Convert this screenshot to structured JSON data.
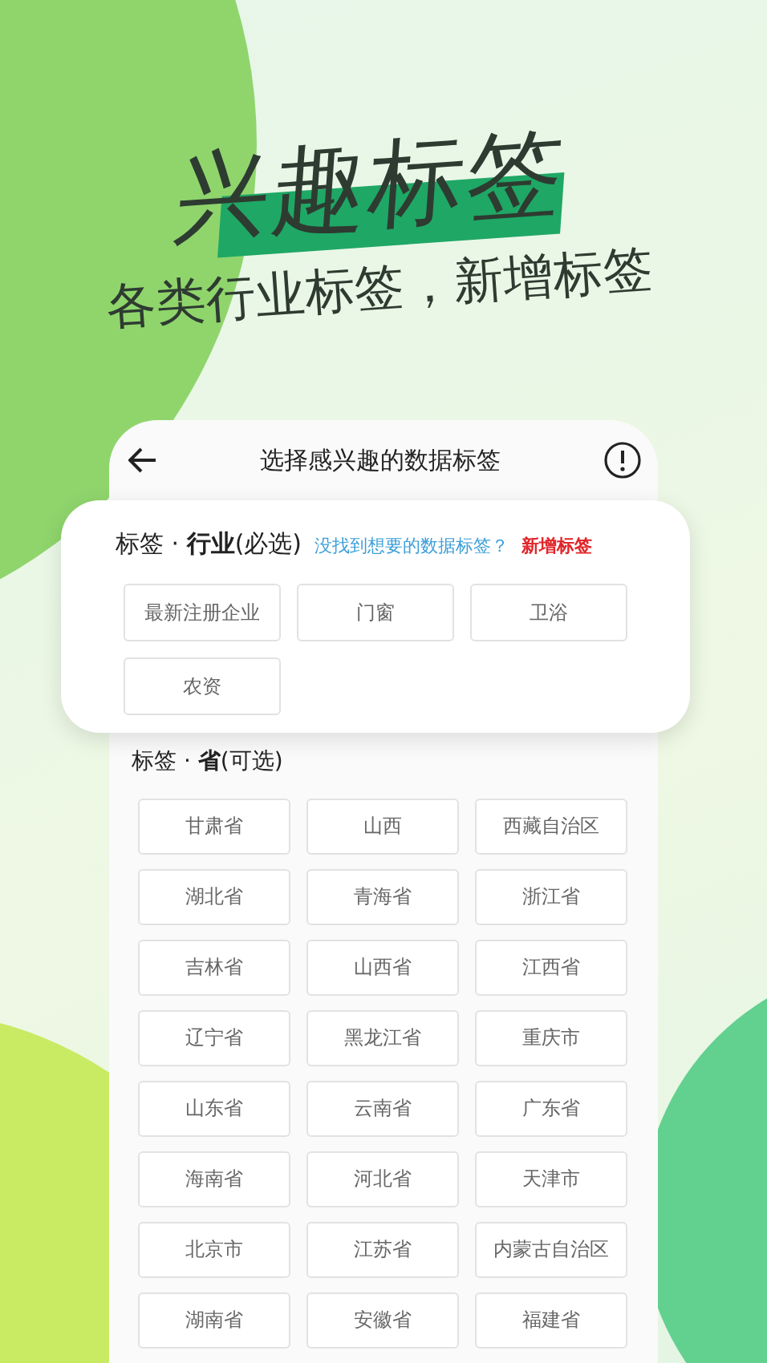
{
  "hero": {
    "title": "兴趣标签",
    "subtitle": "各类行业标签，新增标签"
  },
  "header": {
    "title": "选择感兴趣的数据标签"
  },
  "industry": {
    "heading": "标签 · **行业**(必选)",
    "hint": "没找到想要的数据标签？",
    "add_link": "新增标签",
    "tags": [
      "最新注册企业",
      "门窗",
      "卫浴",
      "农资"
    ]
  },
  "province": {
    "heading": "标签 · **省**(可选)",
    "tags": [
      "甘肃省",
      "山西",
      "西藏自治区",
      "湖北省",
      "青海省",
      "浙江省",
      "吉林省",
      "山西省",
      "江西省",
      "辽宁省",
      "黑龙江省",
      "重庆市",
      "山东省",
      "云南省",
      "广东省",
      "海南省",
      "河北省",
      "天津市",
      "北京市",
      "江苏省",
      "内蒙古自治区",
      "湖南省",
      "安徽省",
      "福建省"
    ]
  }
}
